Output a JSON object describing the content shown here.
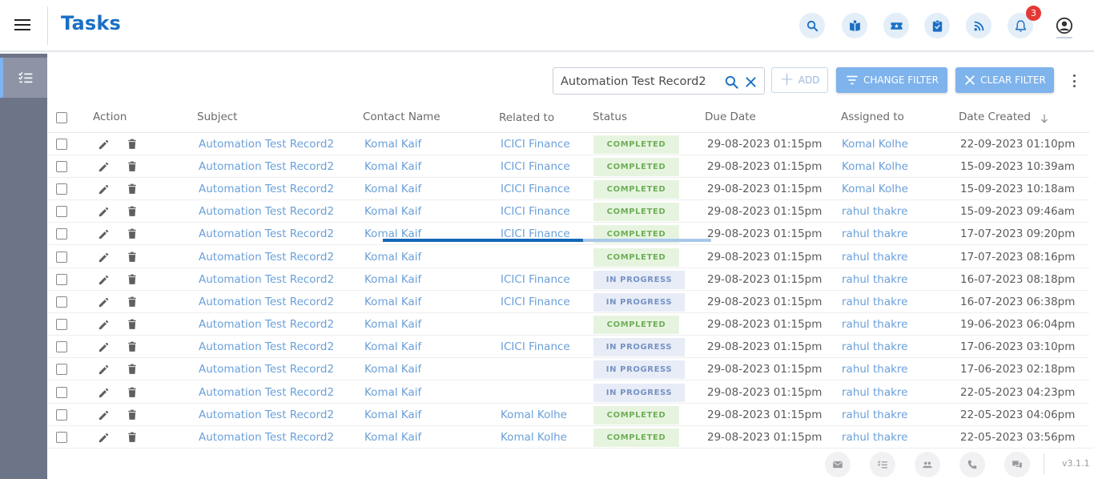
{
  "header": {
    "title": "Tasks",
    "notification_count": "3",
    "icons": [
      "search-icon",
      "contacts-book-icon",
      "ticket-icon",
      "tasks-clipboard-icon",
      "rss-feed-icon",
      "bell-icon",
      "user-account-icon"
    ],
    "accent_color": "#1a6fc4"
  },
  "sidebar": {
    "items": [
      {
        "name": "tasks-list-icon",
        "active": true
      }
    ]
  },
  "toolbar": {
    "search_value": "Automation Test Record2",
    "add_label": "ADD",
    "change_filter_label": "CHANGE FILTER",
    "clear_filter_label": "CLEAR FILTER"
  },
  "table": {
    "columns": [
      "Action",
      "Subject",
      "Contact Name",
      "Related to",
      "Status",
      "Due Date",
      "Assigned to",
      "Date Created"
    ],
    "sort_column": "Date Created",
    "sort_direction": "descending",
    "rows": [
      {
        "subject": "Automation Test Record2",
        "contact": "Komal Kaif",
        "related": "ICICI Finance",
        "status": "COMPLETED",
        "due": "29-08-2023 01:15pm",
        "assigned": "Komal Kolhe",
        "created": "22-09-2023 01:10pm"
      },
      {
        "subject": "Automation Test Record2",
        "contact": "Komal Kaif",
        "related": "ICICI Finance",
        "status": "COMPLETED",
        "due": "29-08-2023 01:15pm",
        "assigned": "Komal Kolhe",
        "created": "15-09-2023 10:39am"
      },
      {
        "subject": "Automation Test Record2",
        "contact": "Komal Kaif",
        "related": "ICICI Finance",
        "status": "COMPLETED",
        "due": "29-08-2023 01:15pm",
        "assigned": "Komal Kolhe",
        "created": "15-09-2023 10:18am"
      },
      {
        "subject": "Automation Test Record2",
        "contact": "Komal Kaif",
        "related": "ICICI Finance",
        "status": "COMPLETED",
        "due": "29-08-2023 01:15pm",
        "assigned": "rahul thakre",
        "created": "15-09-2023 09:46am"
      },
      {
        "subject": "Automation Test Record2",
        "contact": "Komal Kaif",
        "related": "ICICI Finance",
        "status": "COMPLETED",
        "due": "29-08-2023 01:15pm",
        "assigned": "rahul thakre",
        "created": "17-07-2023 09:20pm"
      },
      {
        "subject": "Automation Test Record2",
        "contact": "Komal Kaif",
        "related": "",
        "status": "COMPLETED",
        "due": "29-08-2023 01:15pm",
        "assigned": "rahul thakre",
        "created": "17-07-2023 08:16pm"
      },
      {
        "subject": "Automation Test Record2",
        "contact": "Komal Kaif",
        "related": "ICICI Finance",
        "status": "IN PROGRESS",
        "due": "29-08-2023 01:15pm",
        "assigned": "rahul thakre",
        "created": "16-07-2023 08:18pm"
      },
      {
        "subject": "Automation Test Record2",
        "contact": "Komal Kaif",
        "related": "ICICI Finance",
        "status": "IN PROGRESS",
        "due": "29-08-2023 01:15pm",
        "assigned": "rahul thakre",
        "created": "16-07-2023 06:38pm"
      },
      {
        "subject": "Automation Test Record2",
        "contact": "Komal Kaif",
        "related": "",
        "status": "COMPLETED",
        "due": "29-08-2023 01:15pm",
        "assigned": "rahul thakre",
        "created": "19-06-2023 06:04pm"
      },
      {
        "subject": "Automation Test Record2",
        "contact": "Komal Kaif",
        "related": "ICICI Finance",
        "status": "IN PROGRESS",
        "due": "29-08-2023 01:15pm",
        "assigned": "rahul thakre",
        "created": "17-06-2023 03:10pm"
      },
      {
        "subject": "Automation Test Record2",
        "contact": "Komal Kaif",
        "related": "",
        "status": "IN PROGRESS",
        "due": "29-08-2023 01:15pm",
        "assigned": "rahul thakre",
        "created": "17-06-2023 02:18pm"
      },
      {
        "subject": "Automation Test Record2",
        "contact": "Komal Kaif",
        "related": "",
        "status": "IN PROGRESS",
        "due": "29-08-2023 01:15pm",
        "assigned": "rahul thakre",
        "created": "22-05-2023 04:23pm"
      },
      {
        "subject": "Automation Test Record2",
        "contact": "Komal Kaif",
        "related": "Komal Kolhe",
        "status": "COMPLETED",
        "due": "29-08-2023 01:15pm",
        "assigned": "rahul thakre",
        "created": "22-05-2023 04:06pm"
      },
      {
        "subject": "Automation Test Record2",
        "contact": "Komal Kaif",
        "related": "Komal Kolhe",
        "status": "COMPLETED",
        "due": "29-08-2023 01:15pm",
        "assigned": "rahul thakre",
        "created": "22-05-2023 03:56pm"
      }
    ]
  },
  "loading_progress": 0.61,
  "footer": {
    "icons": [
      "email-icon",
      "task-list-icon",
      "meeting-icon",
      "phone-icon",
      "chat-icon"
    ],
    "version": "v3.1.1"
  }
}
